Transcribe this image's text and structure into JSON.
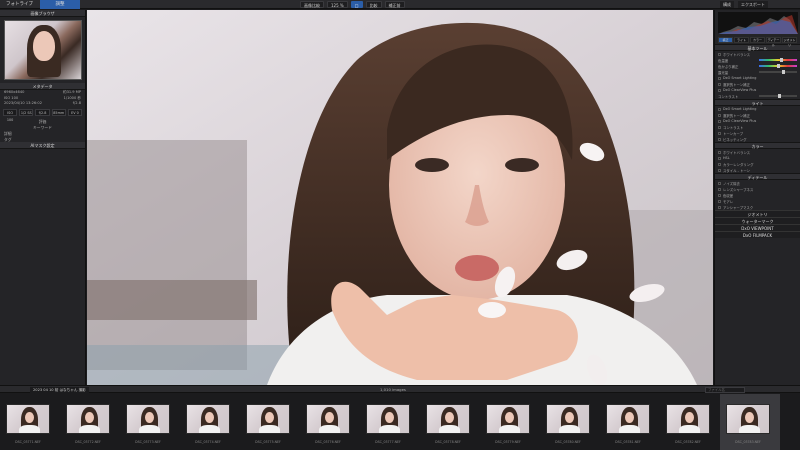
{
  "topbar": {
    "tabs": [
      "フォトライブラリ",
      "調整"
    ],
    "toolbar": [
      "画像比較",
      "125 %",
      "□",
      "比較",
      "補正前"
    ],
    "right": [
      "構成",
      "エクスポート"
    ]
  },
  "left_panel": {
    "browser_title": "画像ブラウザ",
    "metadata_title": "メタデータ",
    "meta_rows": [
      [
        "6960x4640",
        "約31.9 MP"
      ],
      [
        "ISO 100",
        "1/1000 秒"
      ],
      [
        "2023/04/10 13:26:02",
        "f/2.8"
      ]
    ],
    "meta_cells": [
      "ISO 100",
      "1/2 SS",
      "f/2.8",
      "85mm",
      "EV 0"
    ],
    "rating_label": "評価",
    "keywords_label": "キーワード",
    "advanced_label": "詳細",
    "tags_label": "タグ",
    "ai_label": "AIマスク設定"
  },
  "right_panel": {
    "tabs": [
      "補正",
      "ライト",
      "カラー",
      "ディテール",
      "ジオメトリ"
    ],
    "sections": [
      {
        "title": "基本ツール",
        "rows": [
          "ホワイトバランス",
          "色温度",
          "色かぶり補正",
          "露光量",
          "DxO Smart Lighting",
          "選択的トーン補正",
          "DxO ClearView Plus",
          "コントラスト"
        ]
      },
      {
        "title": "ライト",
        "rows": [
          "DxO Smart Lighting",
          "選択的トーン補正",
          "DxO ClearView Plus",
          "コントラスト",
          "トーンカーブ",
          "ビネッティング"
        ]
      },
      {
        "title": "カラー",
        "rows": [
          "ホワイトバランス",
          "HSL",
          "カラーレンダリング",
          "スタイル - トーン"
        ]
      },
      {
        "title": "ディテール",
        "rows": [
          "ノイズ除去",
          "レンズシャープネス",
          "色収差",
          "モアレ",
          "アンシャープマスク"
        ]
      }
    ],
    "bottom": [
      "ジオメトリ",
      "ウォーターマーク",
      "DxO VIEWPOINT",
      "DxO FILMPACK"
    ]
  },
  "filmbar": {
    "path": "2023 04 10 桜 はなちゃん 撮影",
    "count": "1,010 images",
    "search_placeholder": "ファイル名"
  },
  "filmstrip": [
    {
      "name": "DSC_03771.NEF"
    },
    {
      "name": "DSC_03772.NEF"
    },
    {
      "name": "DSC_03773.NEF"
    },
    {
      "name": "DSC_03774.NEF"
    },
    {
      "name": "DSC_03775.NEF"
    },
    {
      "name": "DSC_03776.NEF"
    },
    {
      "name": "DSC_03777.NEF"
    },
    {
      "name": "DSC_03778.NEF"
    },
    {
      "name": "DSC_03779.NEF"
    },
    {
      "name": "DSC_03780.NEF"
    },
    {
      "name": "DSC_03781.NEF"
    },
    {
      "name": "DSC_03782.NEF"
    },
    {
      "name": "DSC_03783.NEF",
      "selected": true
    }
  ],
  "colors": {
    "accent": "#2b5ea8",
    "panel": "#242427",
    "background": "#1b1b1d"
  }
}
